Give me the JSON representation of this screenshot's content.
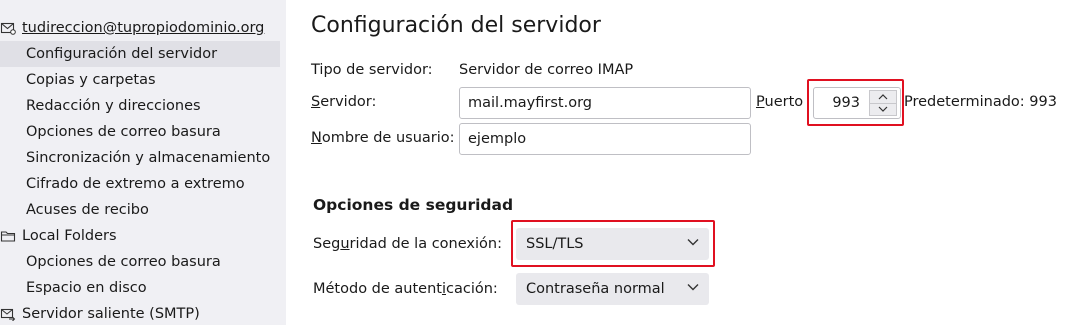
{
  "sidebar": {
    "account": {
      "icon": "mail-account-icon",
      "label": "tudireccion@tupropiodominio.org"
    },
    "account_items": [
      {
        "label": "Configuración del servidor",
        "selected": true
      },
      {
        "label": "Copias y carpetas"
      },
      {
        "label": "Redacción y direcciones"
      },
      {
        "label": "Opciones de correo basura"
      },
      {
        "label": "Sincronización y almacenamiento"
      },
      {
        "label": "Cifrado de extremo a extremo"
      },
      {
        "label": "Acuses de recibo"
      }
    ],
    "local_folders": {
      "icon": "folder-icon",
      "label": "Local Folders"
    },
    "local_items": [
      {
        "label": "Opciones de correo basura"
      },
      {
        "label": "Espacio en disco"
      }
    ],
    "smtp": {
      "icon": "outgoing-server-icon",
      "label": "Servidor saliente (SMTP)"
    }
  },
  "main": {
    "title": "Configuración del servidor",
    "server_type_label": "Tipo de servidor:",
    "server_type_value": "Servidor de correo IMAP",
    "server_label_u": "S",
    "server_label_rest": "ervidor:",
    "server_value": "mail.mayfirst.org",
    "port_label_u": "P",
    "port_label_rest": "uerto",
    "port_value": "993",
    "port_default": "Predeterminado: 993",
    "username_label_u": "N",
    "username_label_rest": "ombre de usuario:",
    "username_value": "ejemplo",
    "security_title": "Opciones de seguridad",
    "conn_security_label_pre": "Seg",
    "conn_security_label_u": "u",
    "conn_security_label_post": "ridad de la conexión:",
    "conn_security_value": "SSL/TLS",
    "auth_label_pre": "Método de autent",
    "auth_label_u": "i",
    "auth_label_post": "cación:",
    "auth_value": "Contraseña normal"
  },
  "colors": {
    "highlight": "#e01020",
    "sidebar_bg": "#f0f0f4",
    "selected_bg": "#e0e0e6"
  }
}
